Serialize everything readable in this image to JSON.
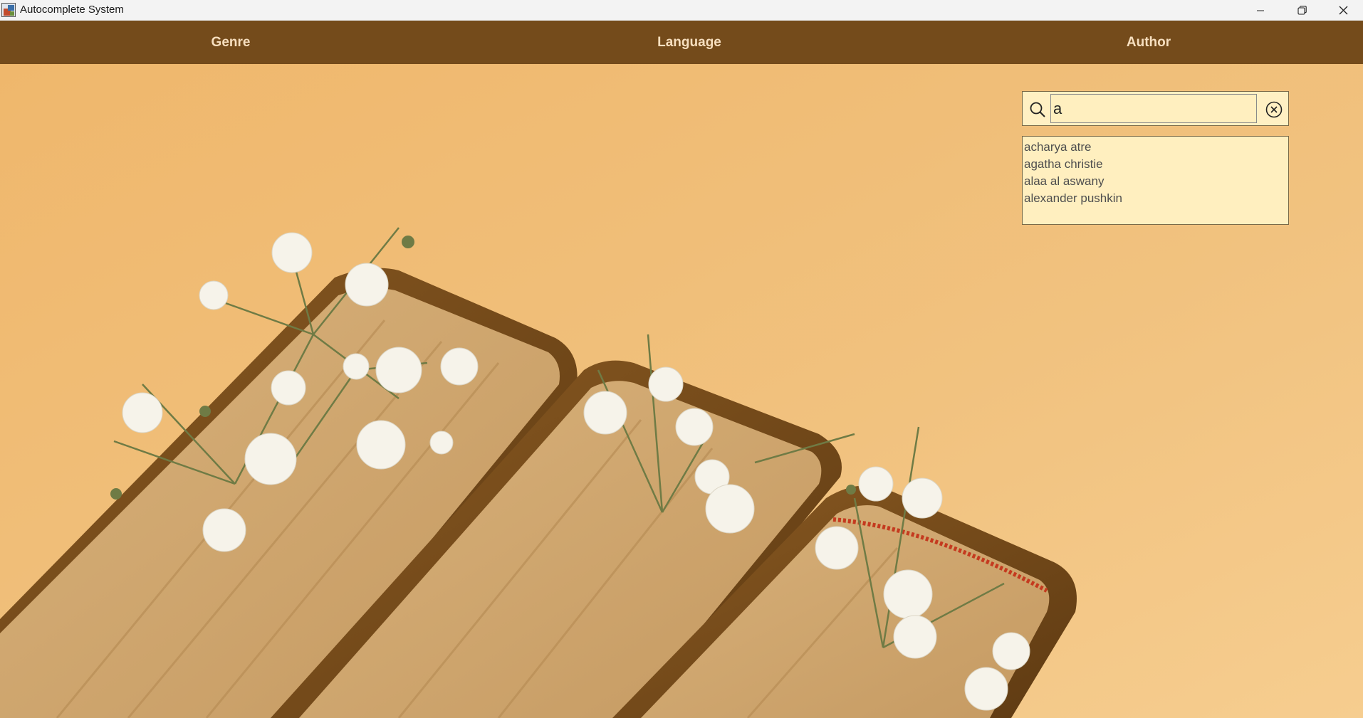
{
  "window": {
    "title": "Autocomplete System",
    "controls": [
      "minimize-icon",
      "restore-icon",
      "close-icon"
    ]
  },
  "menu": {
    "items": [
      {
        "label": "Genre"
      },
      {
        "label": "Language"
      },
      {
        "label": "Author"
      }
    ]
  },
  "search": {
    "value": "a",
    "icon": "search-icon",
    "clear_icon": "clear-circle-x-icon"
  },
  "suggestions": [
    "acharya atre",
    "agatha christie",
    "alaa al aswany",
    "alexander pushkin"
  ],
  "colors": {
    "menubar": "#744b1b",
    "menu_text": "#f7dfbf",
    "background": "#f0c080",
    "search_bg": "#ffefbf"
  }
}
